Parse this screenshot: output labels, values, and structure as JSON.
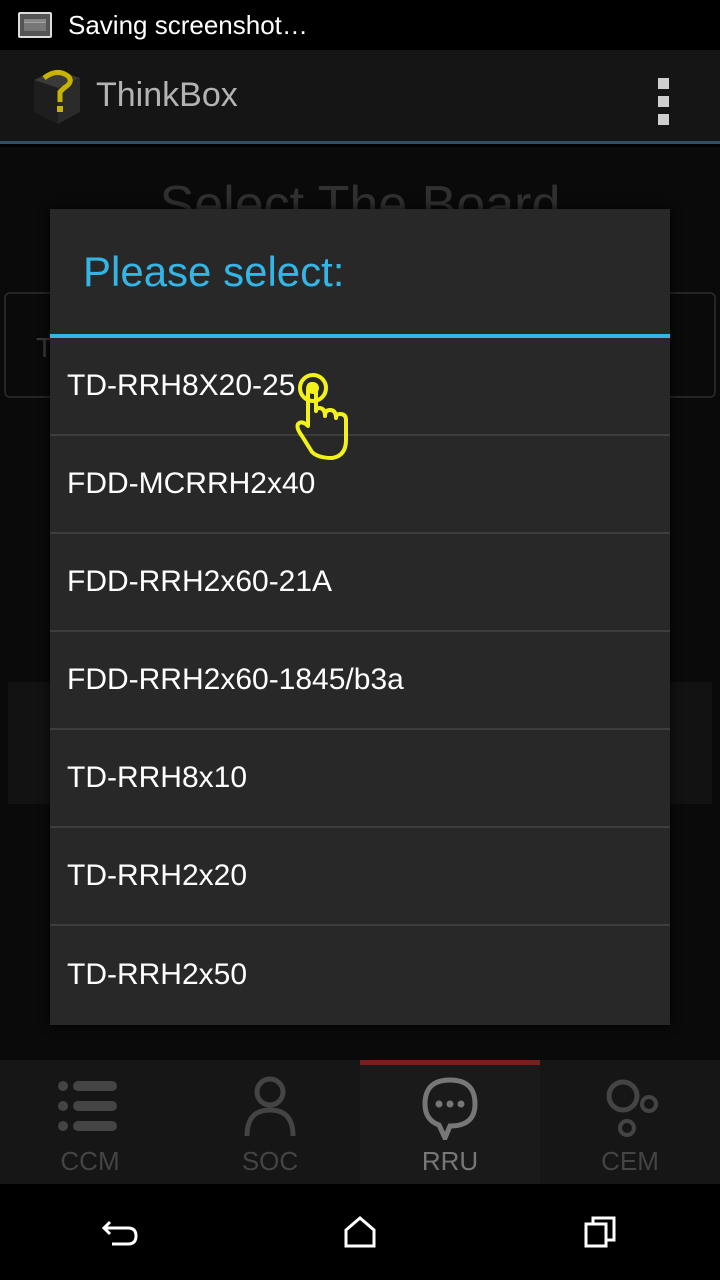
{
  "status_bar": {
    "text": "Saving screenshot…"
  },
  "action_bar": {
    "title": "ThinkBox",
    "logo_icon": "cube-question-icon",
    "menu_icon": "overflow-menu-icon"
  },
  "background": {
    "heading": "Select The Board",
    "field_text": "T"
  },
  "dialog": {
    "title": "Please select:",
    "options": [
      "TD-RRH8X20-25",
      "FDD-MCRRH2x40",
      "FDD-RRH2x60-21A",
      "FDD-RRH2x60-1845/b3a",
      "TD-RRH8x10",
      "TD-RRH2x20",
      "TD-RRH2x50"
    ]
  },
  "tabs": [
    {
      "label": "CCM",
      "icon": "list-icon",
      "active": false
    },
    {
      "label": "SOC",
      "icon": "person-icon",
      "active": false
    },
    {
      "label": "RRU",
      "icon": "chat-bubble-icon",
      "active": true
    },
    {
      "label": "CEM",
      "icon": "circles-icon",
      "active": false
    }
  ],
  "nav": {
    "back": "back-icon",
    "home": "home-icon",
    "recents": "recents-icon"
  },
  "colors": {
    "accent": "#33b5e5",
    "active_tab": "#7a1f1f",
    "pointer": "#f2f21a"
  }
}
